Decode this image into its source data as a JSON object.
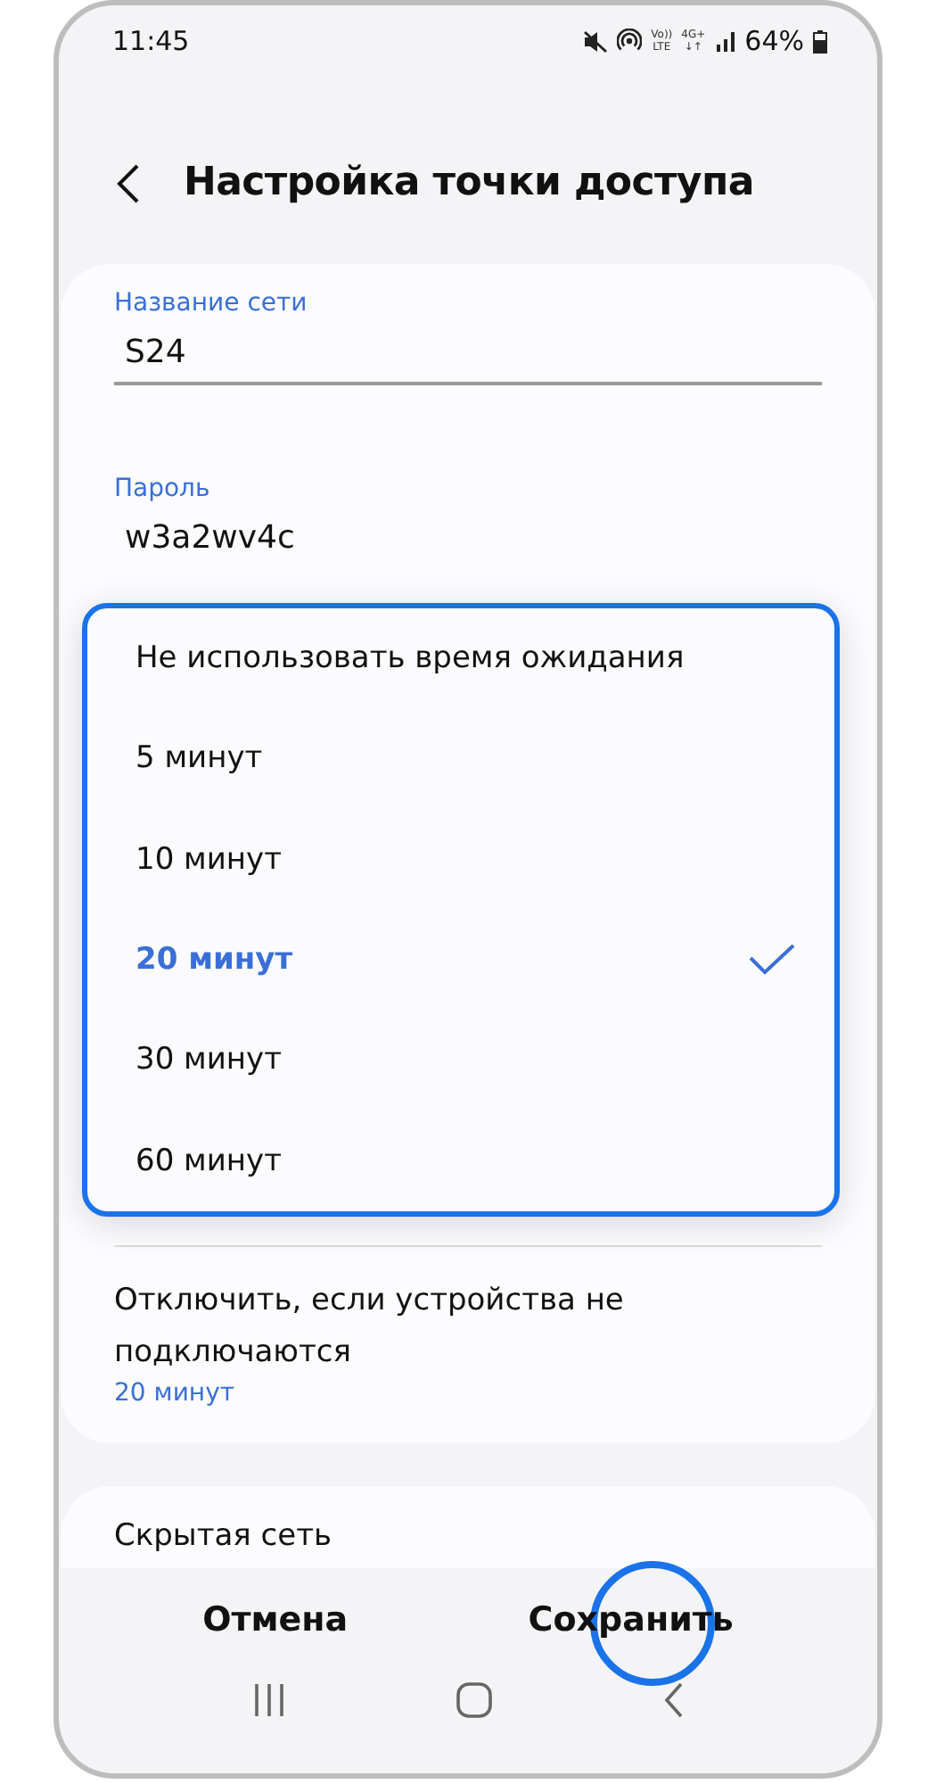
{
  "status_bar": {
    "time": "11:45",
    "indicators": [
      {
        "top": "Vo))",
        "bottom": "LTE"
      },
      {
        "top": "4G+",
        "bottom": "↓↑"
      }
    ],
    "battery": "64%"
  },
  "header": {
    "title": "Настройка точки доступа"
  },
  "fields": [
    {
      "label": "Название сети",
      "value": "S24"
    },
    {
      "label": "Пароль",
      "value": "w3a2wv4c"
    }
  ],
  "timeout_menu": {
    "highlighted": true,
    "options": [
      {
        "label": "Не использовать время ожидания",
        "selected": false
      },
      {
        "label": "5 минут",
        "selected": false
      },
      {
        "label": "10 минут",
        "selected": false
      },
      {
        "label": "20 минут",
        "selected": true
      },
      {
        "label": "30 минут",
        "selected": false
      },
      {
        "label": "60 минут",
        "selected": false
      }
    ]
  },
  "settings": [
    {
      "title": "Отключить, если устройства не подключаются",
      "summary": "20 минут"
    }
  ],
  "hidden_network": {
    "title": "Скрытая сеть"
  },
  "actions": [
    {
      "label": "Отмена",
      "highlighted": false
    },
    {
      "label": "Сохранить",
      "highlighted": true
    }
  ]
}
